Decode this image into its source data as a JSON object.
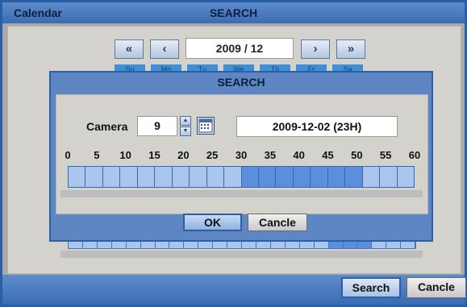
{
  "window": {
    "title_left": "Calendar",
    "title_center": "SEARCH"
  },
  "calendar": {
    "first_label": "«",
    "prev_label": "‹",
    "month": "2009 / 12",
    "next_label": "›",
    "last_label": "»",
    "weekday_labels": [
      "Su",
      "Mo",
      "Tu",
      "We",
      "Th",
      "Fr",
      "Sa"
    ]
  },
  "dialog": {
    "title": "SEARCH",
    "camera_label": "Camera",
    "camera_value": "9",
    "datetime": "2009-12-02 (23H)",
    "minute_ticks": [
      "0",
      "5",
      "10",
      "15",
      "20",
      "25",
      "30",
      "35",
      "40",
      "45",
      "50",
      "55",
      "60"
    ],
    "recorded_minute_segments": [
      10,
      11,
      12,
      13,
      14,
      15,
      16
    ],
    "segments_total": 20,
    "ok_label": "OK",
    "cancel_label": "Cancle"
  },
  "bottom": {
    "search_label": "Search",
    "cancel_label": "Cancle"
  },
  "background_hour_bar": {
    "segments_total": 24,
    "recorded_segments": [
      18,
      19,
      20
    ]
  },
  "icons": {
    "spinner_up": "spin-up-icon",
    "spinner_down": "spin-down-icon",
    "calendar": "calendar-icon"
  },
  "colors": {
    "accent": "#3a6cb3",
    "recorded": "#5b8fde",
    "unrecorded": "#a9c6ee"
  }
}
